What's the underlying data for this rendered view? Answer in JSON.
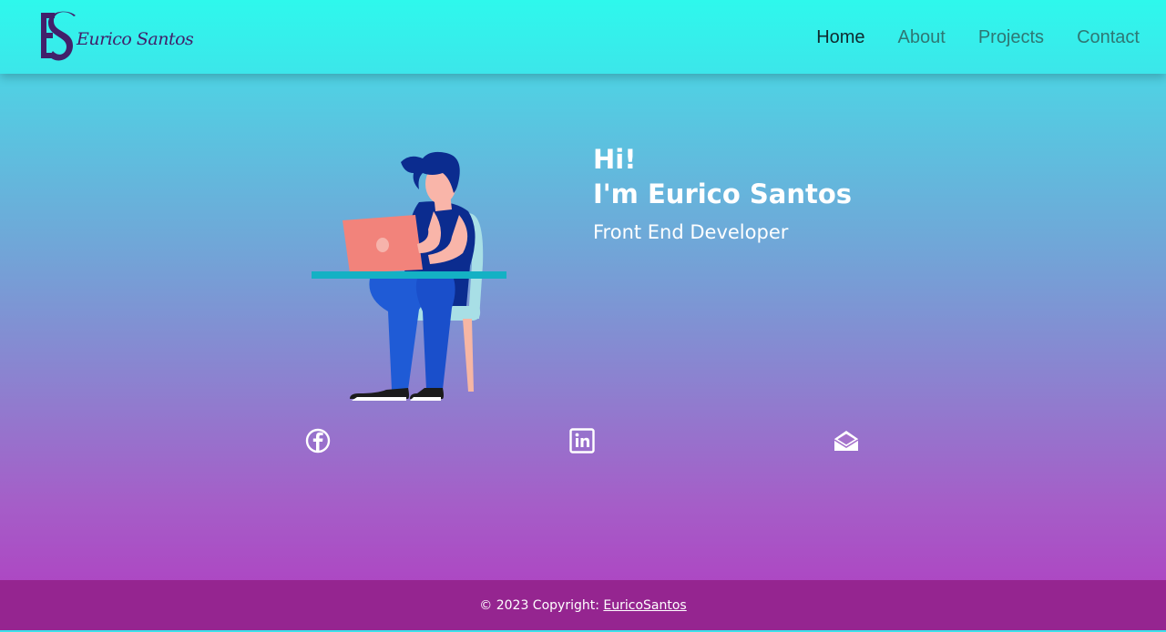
{
  "brand": {
    "monogram": "ES",
    "name": "Eurico Santos"
  },
  "nav": {
    "items": [
      {
        "label": "Home",
        "active": true
      },
      {
        "label": "About",
        "active": false
      },
      {
        "label": "Projects",
        "active": false
      },
      {
        "label": "Contact",
        "active": false
      }
    ]
  },
  "hero": {
    "greeting_line1": "Hi!",
    "greeting_line2": "I'm Eurico Santos",
    "role": "Front End Developer",
    "illustration": "developer-with-laptop-illustration"
  },
  "social": [
    {
      "icon": "facebook-icon"
    },
    {
      "icon": "linkedin-icon"
    },
    {
      "icon": "envelope-open-icon"
    }
  ],
  "footer": {
    "copyright_prefix": "© 2023 Copyright: ",
    "copyright_link": "EuricoSantos"
  },
  "colors": {
    "navbar": "#2ef8ec",
    "footer": "#952590",
    "logo": "#42206a",
    "text_on_gradient": "#ffffff"
  }
}
